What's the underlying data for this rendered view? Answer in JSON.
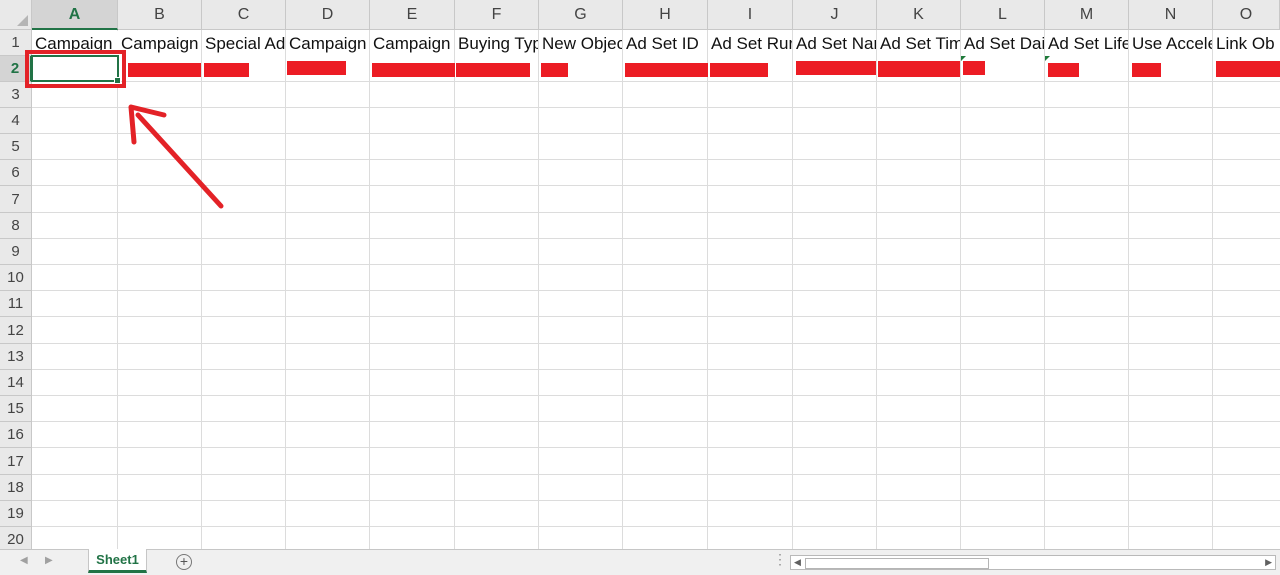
{
  "columns": [
    "A",
    "B",
    "C",
    "D",
    "E",
    "F",
    "G",
    "H",
    "I",
    "J",
    "K",
    "L",
    "M",
    "N",
    "O"
  ],
  "rows": [
    "1",
    "2",
    "3",
    "4",
    "5",
    "6",
    "7",
    "8",
    "9",
    "10",
    "11",
    "12",
    "13",
    "14",
    "15",
    "16",
    "17",
    "18",
    "19",
    "20"
  ],
  "header_row": [
    "Campaign",
    "Campaign",
    "Special Ad",
    "Campaign",
    "Campaign",
    "Buying Typ",
    "New Objec",
    "Ad Set ID",
    "Ad Set Rur",
    "Ad Set Nar",
    "Ad Set Tim",
    "Ad Set Dai",
    "Ad Set Life",
    "Use Accele",
    "Link Ob"
  ],
  "active_cell": {
    "column": "A",
    "row": "2"
  },
  "sheet_tab": "Sheet1",
  "colors": {
    "excel_green": "#217346",
    "annotation_red": "#e32227",
    "redaction_red": "#ec1c24"
  },
  "annotation": {
    "type": "arrow",
    "target": "cell-A2"
  },
  "icons": [
    "tab-prev-icon",
    "tab-next-icon",
    "add-sheet-icon",
    "scroll-left-icon",
    "scroll-right-icon"
  ]
}
